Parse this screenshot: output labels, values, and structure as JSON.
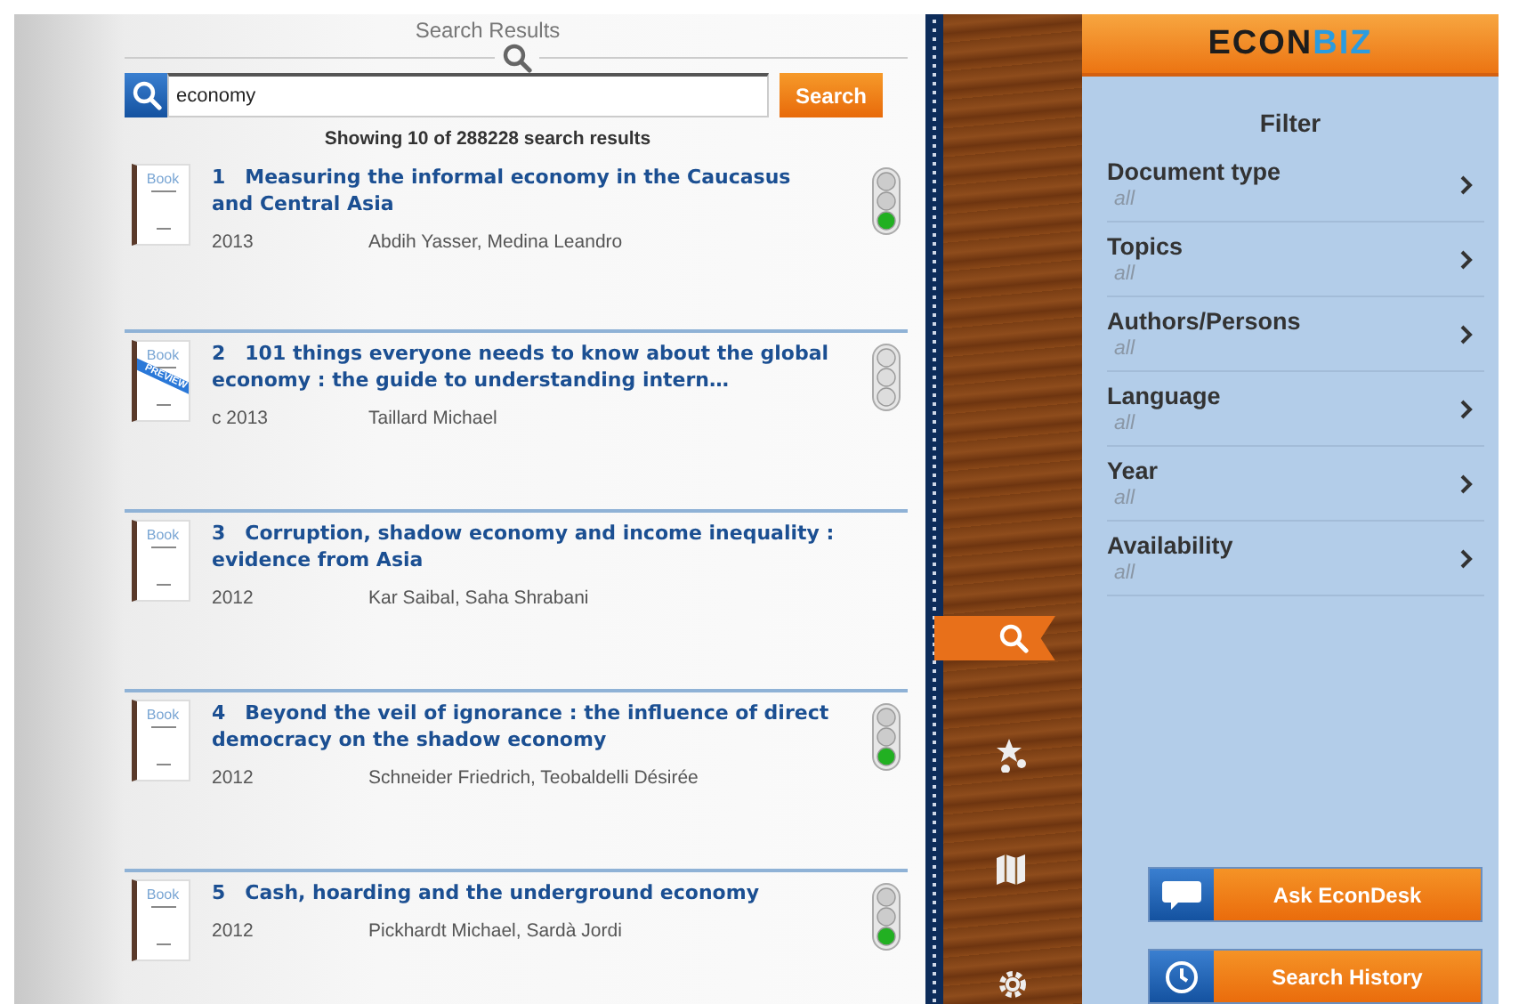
{
  "results_panel": {
    "title": "Search Results",
    "search": {
      "value": "economy"
    },
    "search_button": "Search",
    "summary": "Showing 10 of 288228 search results",
    "results": [
      {
        "number": "1",
        "title": "Measuring the informal economy in the Caucasus and Central Asia",
        "year": "2013",
        "authors": "Abdih Yasser, Medina Leandro",
        "cover": {
          "label": "Book"
        },
        "light": {
          "lit": true
        }
      },
      {
        "number": "2",
        "title": "101 things everyone needs to know about the global economy : the guide to understanding intern…",
        "year": "c 2013",
        "authors": "Taillard Michael",
        "cover": {
          "label": "Book",
          "banner": "PREVIEW"
        },
        "light": {
          "lit": false
        }
      },
      {
        "number": "3",
        "title": "Corruption, shadow economy and income inequality : evidence from Asia",
        "year": "2012",
        "authors": "Kar Saibal, Saha Shrabani",
        "cover": {
          "label": "Book"
        }
      },
      {
        "number": "4",
        "title": "Beyond the veil of ignorance : the influence of direct democracy on the shadow economy",
        "year": "2012",
        "authors": "Schneider Friedrich, Teobaldelli Désirée",
        "cover": {
          "label": "Book"
        },
        "light": {
          "lit": true
        }
      },
      {
        "number": "5",
        "title": "Cash, hoarding and the underground economy",
        "year": "2012",
        "authors": "Pickhardt Michael, Sardà Jordi",
        "cover": {
          "label": "Book"
        },
        "light": {
          "lit": true
        }
      }
    ]
  },
  "nav": [
    {
      "kind": "search",
      "selected": true
    },
    {
      "kind": "favorites",
      "selected": false
    },
    {
      "kind": "map",
      "selected": false
    },
    {
      "kind": "settings",
      "selected": false
    }
  ],
  "filter_panel": {
    "logo": [
      "ECON",
      "BIZ"
    ],
    "title": "Filter",
    "filters": [
      {
        "label": "Document type",
        "value": "all"
      },
      {
        "label": "Topics",
        "value": "all"
      },
      {
        "label": "Authors/Persons",
        "value": "all"
      },
      {
        "label": "Language",
        "value": "all"
      },
      {
        "label": "Year",
        "value": "all"
      },
      {
        "label": "Availability",
        "value": "all"
      }
    ],
    "buttons": [
      {
        "kind": "chat",
        "label": "Ask EconDesk"
      },
      {
        "kind": "history",
        "label": "Search History"
      }
    ]
  }
}
